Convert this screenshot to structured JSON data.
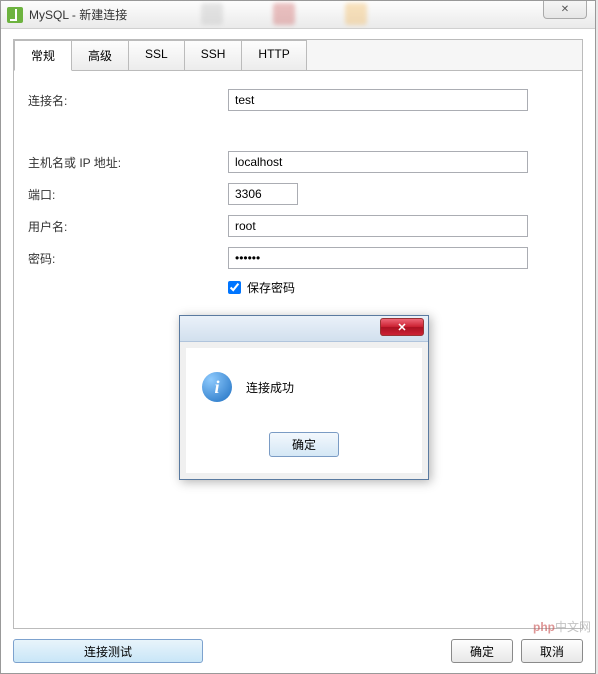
{
  "window": {
    "title": "MySQL - 新建连接",
    "close_label": "✕"
  },
  "tabs": {
    "general": "常规",
    "advanced": "高级",
    "ssl": "SSL",
    "ssh": "SSH",
    "http": "HTTP"
  },
  "form": {
    "connection_name_label": "连接名:",
    "connection_name_value": "test",
    "host_label": "主机名或 IP 地址:",
    "host_value": "localhost",
    "port_label": "端口:",
    "port_value": "3306",
    "username_label": "用户名:",
    "username_value": "root",
    "password_label": "密码:",
    "password_value": "••••••",
    "save_password_label": "保存密码"
  },
  "footer": {
    "test_label": "连接测试",
    "ok_label": "确定",
    "cancel_label": "取消"
  },
  "modal": {
    "message": "连接成功",
    "ok_label": "确定",
    "close_label": "✕",
    "info_glyph": "i"
  },
  "watermark": {
    "php": "php",
    "text": "中文网"
  }
}
